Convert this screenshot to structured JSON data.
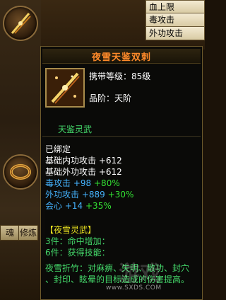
{
  "stats_panel": {
    "rows": [
      "血上限",
      "毒攻击",
      "外功攻击"
    ]
  },
  "tabs": [
    "魂",
    "修炼"
  ],
  "tooltip": {
    "title": "夜雪天鉴双刺",
    "required_level": "携带等级：85级",
    "tier": "品阶：天阶",
    "subtitle": "天鉴灵武",
    "bound": "已绑定",
    "base_stats": [
      {
        "label": "基础内功攻击",
        "value": "+612"
      },
      {
        "label": "基础外功攻击",
        "value": "+612"
      }
    ],
    "bonus_stats": [
      {
        "label": "毒攻击",
        "value": "+98",
        "bonus": "+80%"
      },
      {
        "label": "外功攻击",
        "value": "+889",
        "bonus": "+30%"
      },
      {
        "label": "会心",
        "value": "+14",
        "bonus": "+35%"
      }
    ],
    "set_name": "【夜雪灵武】",
    "set_3": "3件：命中增加：",
    "set_6": "6件：获得技能：",
    "skill_line1": "夜雪折竹：对麻痹、失明、散功、封穴",
    "skill_line2": "、封印、眩晕的目标造成的伤害提高。"
  },
  "watermark": {
    "big": "游戏",
    "url": "www.SXDS.COM"
  },
  "colors": {
    "title": "#ff8a2a",
    "stat_blue": "#45b4ff",
    "bonus_green": "#33e033",
    "set_yellow": "#e8e020"
  },
  "icons": [
    "dagger-icon",
    "bracelet-icon"
  ]
}
